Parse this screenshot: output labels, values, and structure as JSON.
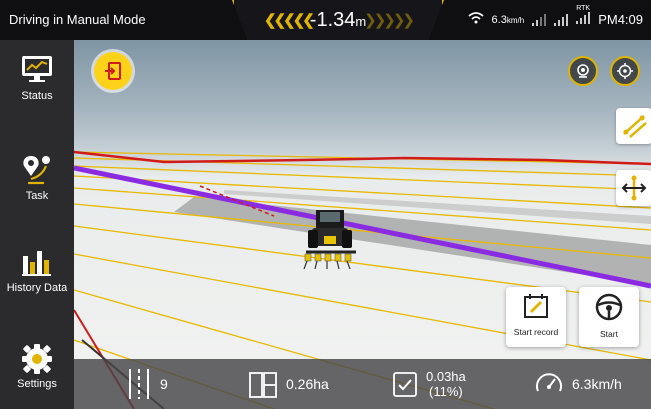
{
  "status_bar": {
    "mode": "Driving in Manual Mode",
    "deviation_value": "-1.34",
    "deviation_unit": "m",
    "speed_indicator": "6.3",
    "speed_indicator_unit": "km/h",
    "rtk_label": "RTK",
    "time": "PM4:09"
  },
  "sidebar": {
    "items": [
      {
        "label": "Status",
        "icon": "monitor-chart-icon"
      },
      {
        "label": "Task",
        "icon": "route-pin-icon"
      },
      {
        "label": "History Data",
        "icon": "bar-chart-icon"
      },
      {
        "label": "Settings",
        "icon": "gear-icon"
      }
    ]
  },
  "controls": {
    "start_record_label": "Start record",
    "start_label": "Start"
  },
  "stats": {
    "line_count": "9",
    "area_total": "0.26ha",
    "area_done": "0.03ha",
    "area_done_percent": "(11%)",
    "speed": "6.3km/h"
  },
  "colors": {
    "accent": "#e0b400",
    "guide_line_active": "#8a2be2",
    "boundary": "#d11a1a",
    "guide_lines": "#e8b800"
  }
}
